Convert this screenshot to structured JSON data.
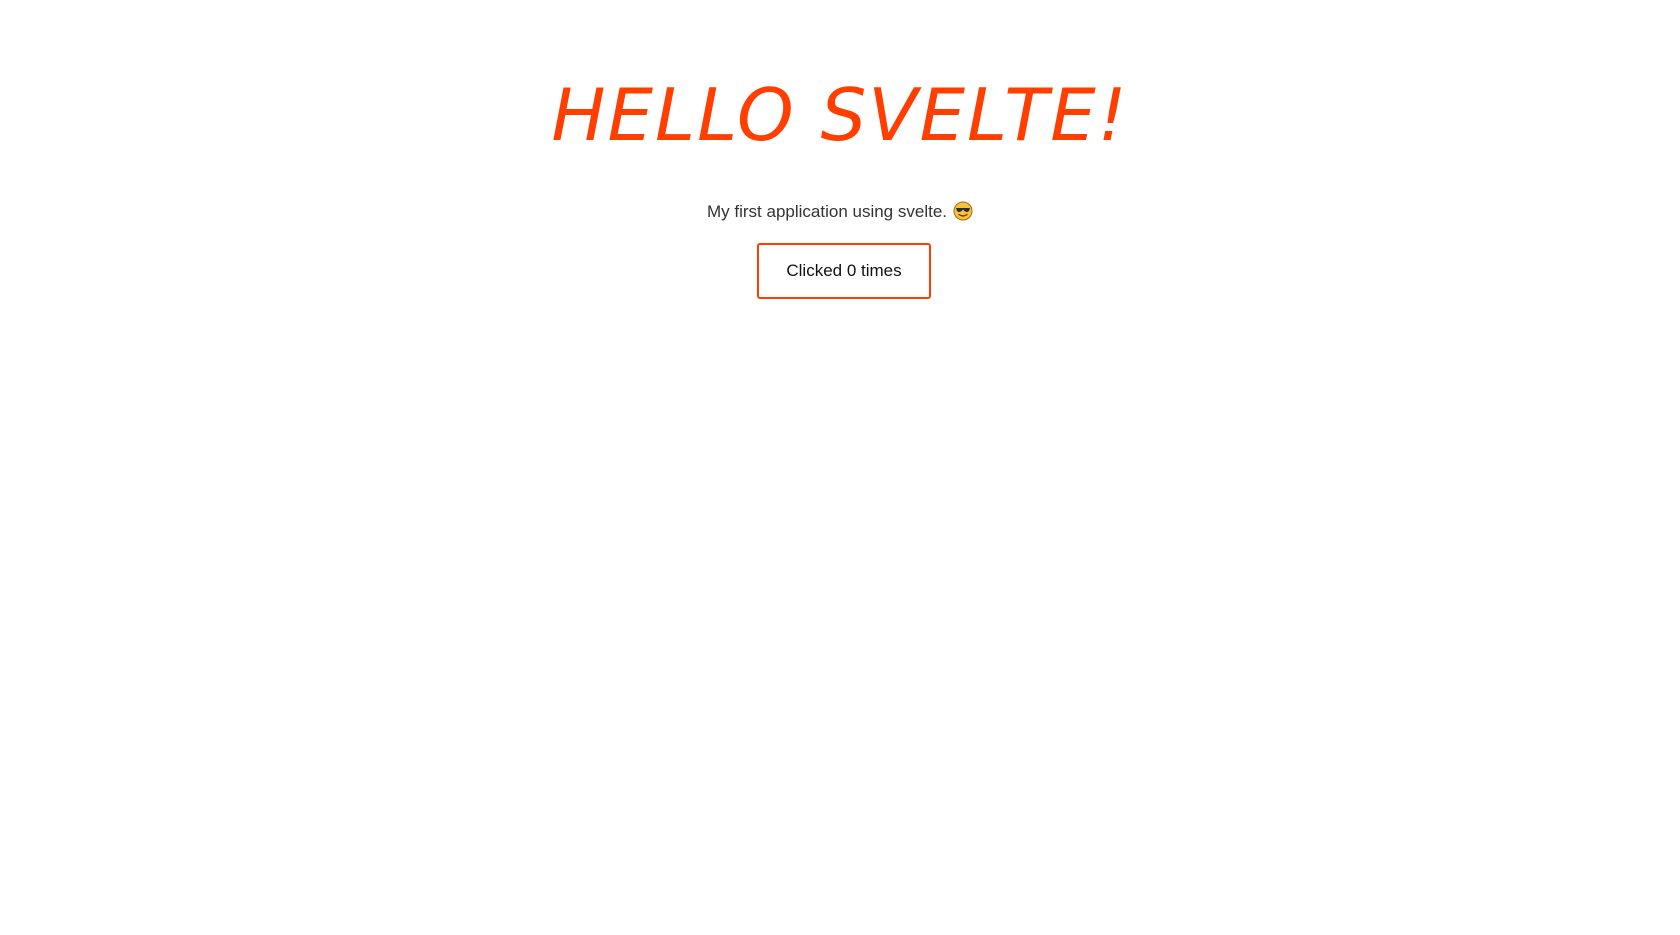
{
  "header": {
    "title": "HELLO SVELTE!"
  },
  "main": {
    "subtitle": "My first application using svelte.",
    "subtitle_emoji": "smiling-face-with-sunglasses-icon",
    "counter_button_label": "Clicked 0 times"
  },
  "colors": {
    "accent": "#ff3e00",
    "text": "#333333",
    "background": "#ffffff"
  }
}
